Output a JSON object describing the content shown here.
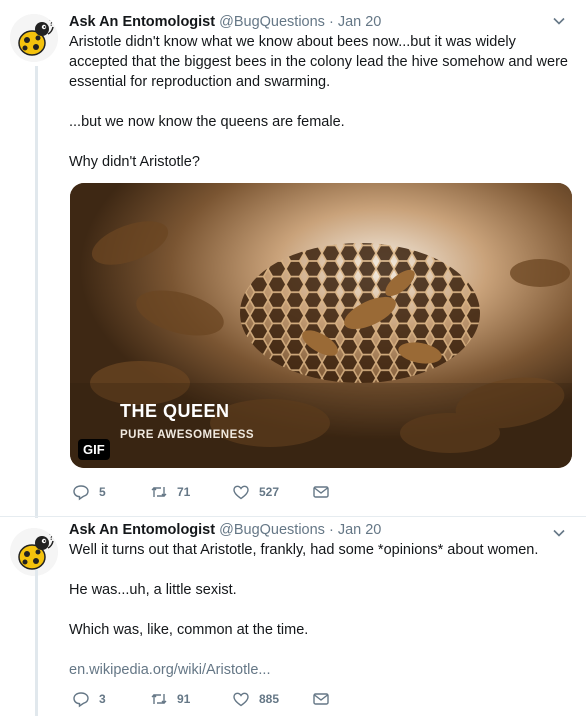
{
  "tweets": [
    {
      "name": "Ask An Entomologist",
      "handle": "@BugQuestions",
      "dot": "·",
      "date": "Jan 20",
      "paragraphs": [
        "Aristotle didn't know what we know about bees now...but it was widely accepted that the biggest bees in the colony lead the hive somehow and were essential for reproduction and swarming.",
        "...but we now know the queens are female.",
        "Why didn't Aristotle?"
      ],
      "media": {
        "overlay_title": "THE QUEEN",
        "overlay_subtitle": "PURE AWESOMENESS",
        "badge": "GIF"
      },
      "actions": {
        "replies": "5",
        "retweets": "71",
        "likes": "527"
      }
    },
    {
      "name": "Ask An Entomologist",
      "handle": "@BugQuestions",
      "dot": "·",
      "date": "Jan 20",
      "paragraphs": [
        "Well it turns out that Aristotle, frankly, had some *opinions* about women.",
        "He was...uh, a little sexist.",
        "Which was, like, common at the time."
      ],
      "link": "en.wikipedia.org/wiki/Aristotle...",
      "actions": {
        "replies": "3",
        "retweets": "91",
        "likes": "885"
      }
    }
  ],
  "icons": {
    "avatar": "ladybug-cartoon-icon",
    "menu": "chevron-down-icon",
    "reply": "reply-icon",
    "retweet": "retweet-icon",
    "like": "heart-icon",
    "message": "envelope-icon"
  },
  "colors": {
    "text": "#14171a",
    "secondary": "#657786",
    "thread": "#e1e8ed"
  }
}
